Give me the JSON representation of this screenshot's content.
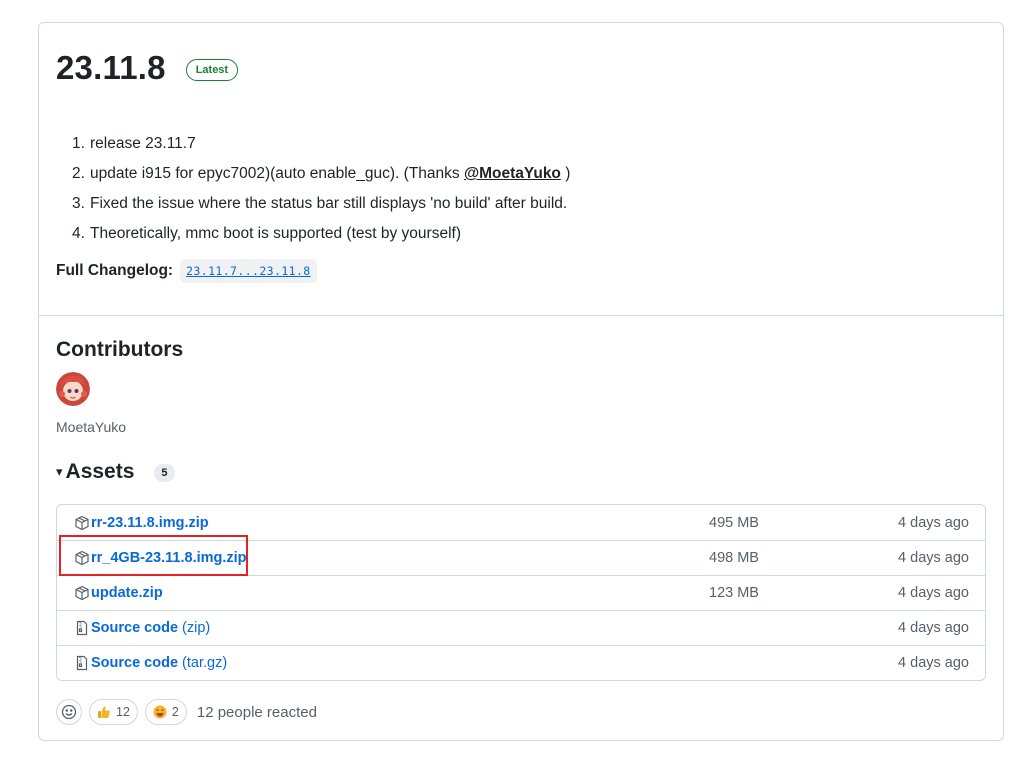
{
  "release": {
    "version": "23.11.8",
    "badge": "Latest",
    "notes": [
      {
        "num": "1.",
        "text": "release 23.11.7"
      },
      {
        "num": "2.",
        "text_before": "update i915 for epyc7002)(auto enable_guc). (Thanks ",
        "mention": "@MoetaYuko",
        "text_after": " )"
      },
      {
        "num": "3.",
        "text": "Fixed the issue where the status bar still displays 'no build' after build."
      },
      {
        "num": "4.",
        "text": "Theoretically, mmc boot is supported (test by yourself)"
      }
    ],
    "changelog_label": "Full Changelog:",
    "changelog_link": "23.11.7...23.11.8"
  },
  "contributors": {
    "title": "Contributors",
    "name": "MoetaYuko"
  },
  "assets": {
    "caret": "▾",
    "title": "Assets",
    "count": "5",
    "rows": [
      {
        "icon": "package-icon",
        "name": "rr-23.11.8.img.zip",
        "suffix": "",
        "size": "495 MB",
        "date": "4 days ago"
      },
      {
        "icon": "package-icon",
        "name": "rr_4GB-23.11.8.img.zip",
        "suffix": "",
        "size": "498 MB",
        "date": "4 days ago"
      },
      {
        "icon": "package-icon",
        "name": "update.zip",
        "suffix": "",
        "size": "123 MB",
        "date": "4 days ago"
      },
      {
        "icon": "file-zip-icon",
        "name": "Source code",
        "suffix": "(zip)",
        "size": "",
        "date": "4 days ago"
      },
      {
        "icon": "file-zip-icon",
        "name": "Source code",
        "suffix": "(tar.gz)",
        "size": "",
        "date": "4 days ago"
      }
    ]
  },
  "reactions": {
    "thumbs_count": "12",
    "laugh_count": "2",
    "summary": "12 people reacted"
  },
  "colors": {
    "link": "#0969da",
    "success": "#1a7f37",
    "highlight": "#e02424"
  }
}
